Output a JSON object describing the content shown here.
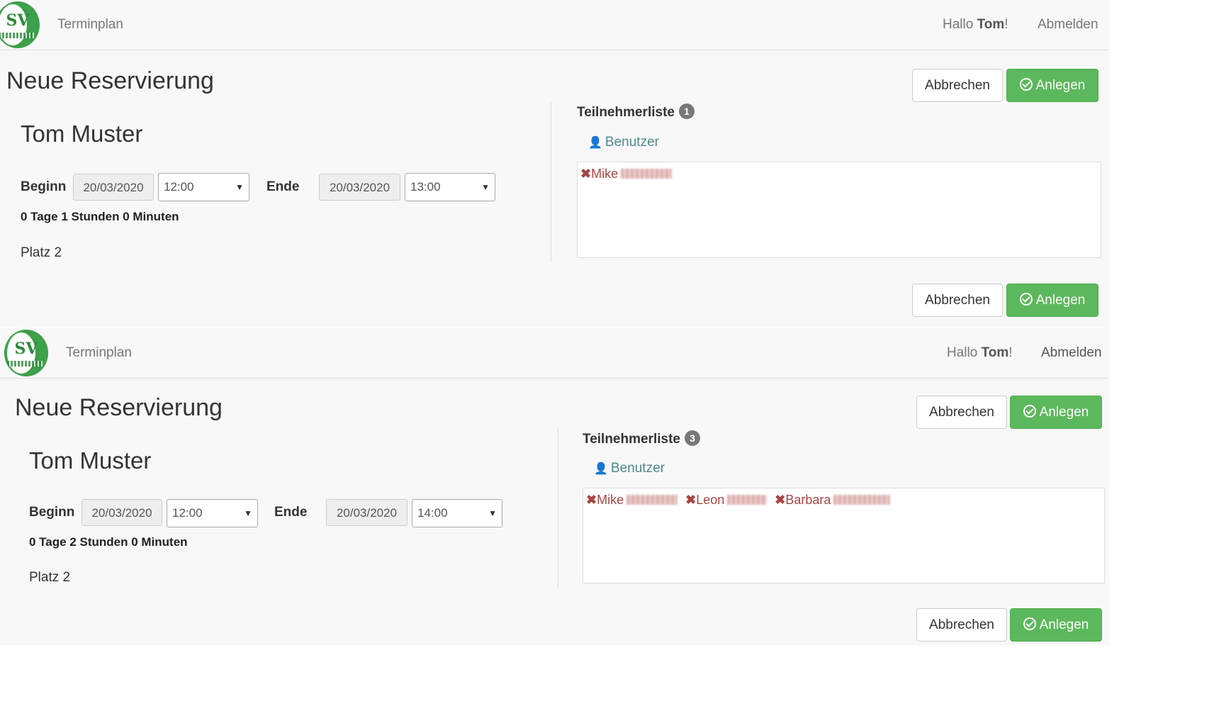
{
  "panels": [
    {
      "nav": {
        "brand": "Terminplan",
        "greeting_prefix": "Hallo",
        "user": "Tom",
        "greeting_suffix": "!",
        "logout": "Abmelden",
        "logo_text": "SV"
      },
      "title": "Neue Reservierung",
      "person": "Tom Muster",
      "begin_label": "Beginn",
      "begin_date": "20/03/2020",
      "begin_time": "12:00",
      "end_label": "Ende",
      "end_date": "20/03/2020",
      "end_time": "13:00",
      "duration": "0 Tage 1 Stunden 0 Minuten",
      "place": "Platz 2",
      "participants_title": "Teilnehmerliste",
      "participants_count": "1",
      "user_link": "Benutzer",
      "participants": [
        {
          "x": "✖",
          "name": "Mike"
        }
      ],
      "cancel_label": "Abbrechen",
      "create_label": "Anlegen"
    },
    {
      "nav": {
        "brand": "Terminplan",
        "greeting_prefix": "Hallo",
        "user": "Tom",
        "greeting_suffix": "!",
        "logout": "Abmelden",
        "logo_text": "SV"
      },
      "title": "Neue Reservierung",
      "person": "Tom Muster",
      "begin_label": "Beginn",
      "begin_date": "20/03/2020",
      "begin_time": "12:00",
      "end_label": "Ende",
      "end_date": "20/03/2020",
      "end_time": "14:00",
      "duration": "0 Tage 2 Stunden 0 Minuten",
      "place": "Platz 2",
      "participants_title": "Teilnehmerliste",
      "participants_count": "3",
      "user_link": "Benutzer",
      "participants": [
        {
          "x": "✖",
          "name": "Mike"
        },
        {
          "x": "✖",
          "name": "Leon"
        },
        {
          "x": "✖",
          "name": "Barbara"
        }
      ],
      "cancel_label": "Abbrechen",
      "create_label": "Anlegen"
    }
  ],
  "icons": {
    "user": "user-icon",
    "check": "check-circle-icon",
    "remove": "remove-icon",
    "caret": "caret-down-icon"
  },
  "colors": {
    "success": "#5cb85c",
    "danger_text": "#a94442",
    "link": "#4e8a8a"
  }
}
